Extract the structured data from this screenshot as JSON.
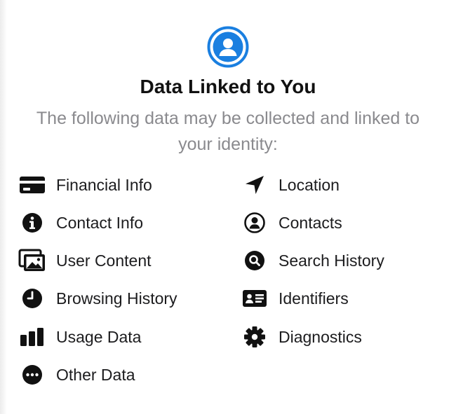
{
  "header": {
    "icon": "person-circle-icon",
    "accent_color": "#1a7fe0",
    "title": "Data Linked to You",
    "subtitle": "The following data may be collected and linked to your identity:"
  },
  "items": {
    "financial_info": {
      "label": "Financial Info",
      "icon": "credit-card-icon"
    },
    "contact_info": {
      "label": "Contact Info",
      "icon": "info-circle-icon"
    },
    "user_content": {
      "label": "User Content",
      "icon": "photos-icon"
    },
    "browsing_history": {
      "label": "Browsing History",
      "icon": "clock-icon"
    },
    "usage_data": {
      "label": "Usage Data",
      "icon": "bar-chart-icon"
    },
    "other_data": {
      "label": "Other Data",
      "icon": "ellipsis-circle-icon"
    },
    "location": {
      "label": "Location",
      "icon": "location-arrow-icon"
    },
    "contacts": {
      "label": "Contacts",
      "icon": "person-circle-outline-icon"
    },
    "search_history": {
      "label": "Search History",
      "icon": "magnifier-circle-icon"
    },
    "identifiers": {
      "label": "Identifiers",
      "icon": "id-card-icon"
    },
    "diagnostics": {
      "label": "Diagnostics",
      "icon": "gear-icon"
    }
  }
}
